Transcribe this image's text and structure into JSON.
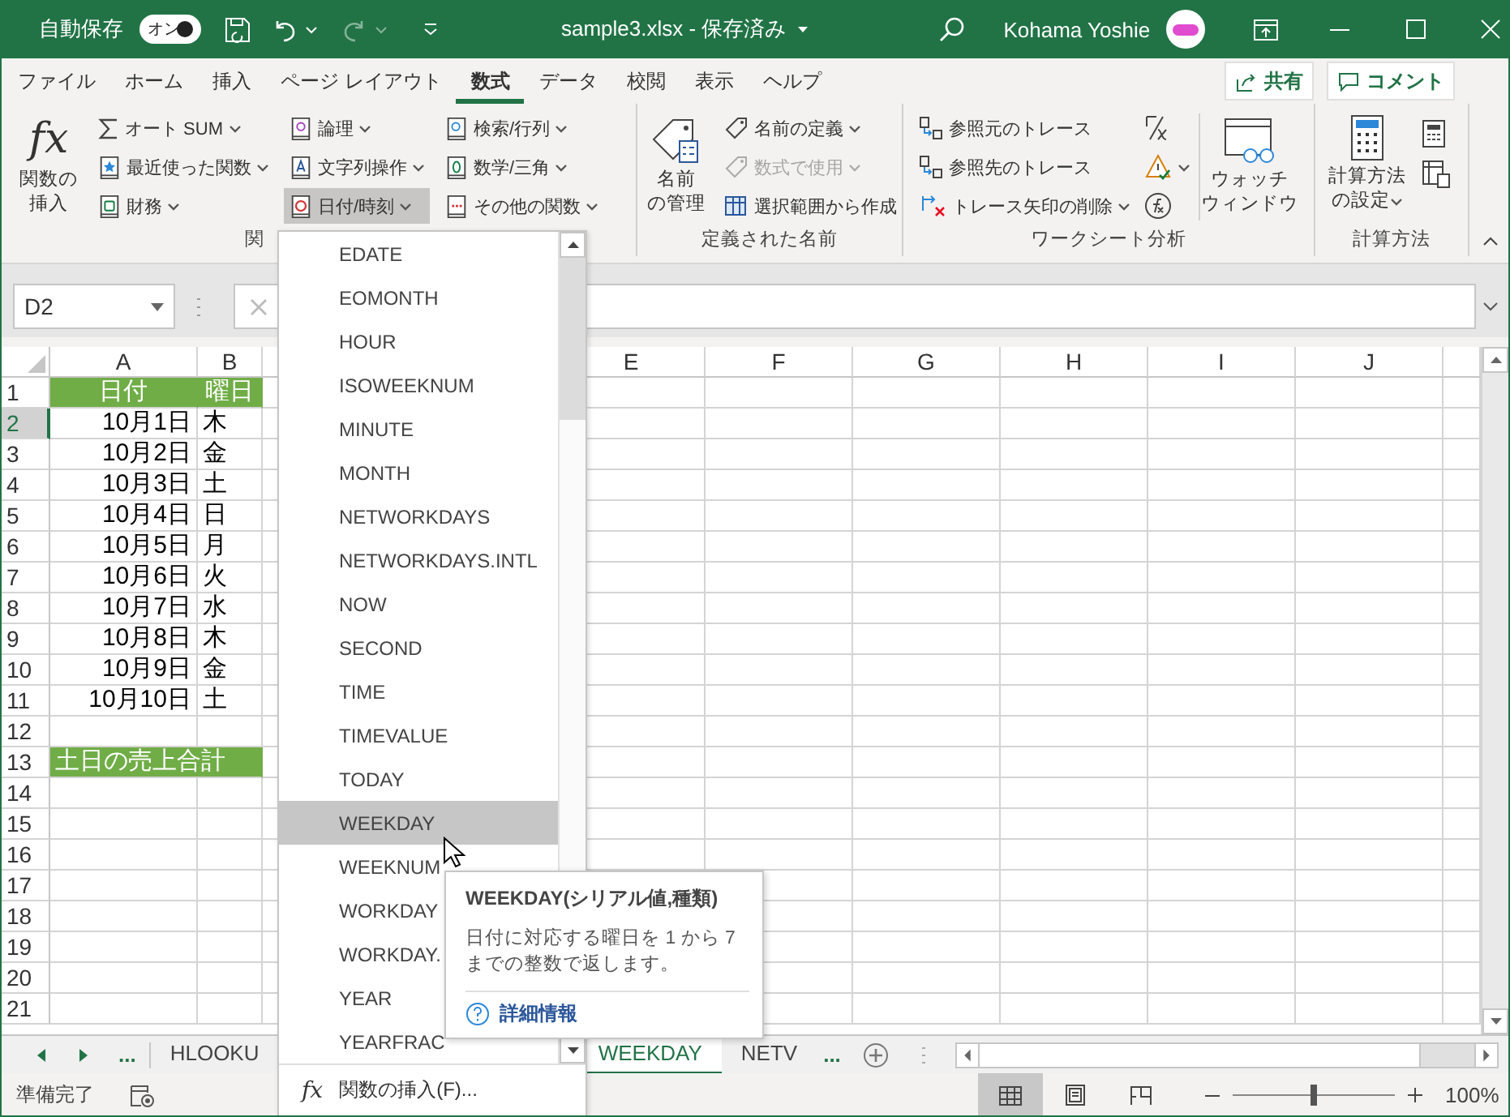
{
  "titlebar": {
    "autosave": "自動保存",
    "toggle": {
      "label": "オン",
      "on": true
    },
    "redo": {
      "disabled": true
    },
    "title": "sample3.xlsx - 保存済み",
    "user": "Kohama Yoshie"
  },
  "tabs": [
    {
      "label": "ファイル",
      "selected": false
    },
    {
      "label": "ホーム",
      "selected": false
    },
    {
      "label": "挿入",
      "selected": false
    },
    {
      "label": "ページ レイアウト",
      "selected": false
    },
    {
      "label": "数式",
      "selected": true
    },
    {
      "label": "データ",
      "selected": false
    },
    {
      "label": "校閲",
      "selected": false
    },
    {
      "label": "表示",
      "selected": false
    },
    {
      "label": "ヘルプ",
      "selected": false
    }
  ],
  "share": "共有",
  "comment": "コメント",
  "ribbon": {
    "library": {
      "icon_text": "fx",
      "insert": [
        "関数の",
        "挿入"
      ],
      "label": "関",
      "columns": [
        [
          {
            "label": "オート SUM",
            "kind": "sum",
            "pressed": false
          },
          {
            "label": "最近使った関数",
            "kind": "recent",
            "pressed": false
          },
          {
            "label": "財務",
            "kind": "finance",
            "pressed": false
          }
        ],
        [
          {
            "label": "論理",
            "kind": "logic",
            "pressed": false
          },
          {
            "label": "文字列操作",
            "kind": "text",
            "pressed": false
          },
          {
            "label": "日付/時刻",
            "kind": "datetime",
            "pressed": true
          }
        ],
        [
          {
            "label": "検索/行列",
            "kind": "lookup",
            "pressed": false
          },
          {
            "label": "数学/三角",
            "kind": "math",
            "pressed": false
          },
          {
            "label": "その他の関数",
            "kind": "more",
            "pressed": false
          }
        ]
      ]
    },
    "names": {
      "manager": [
        "名前",
        "の管理"
      ],
      "label": "定義された名前",
      "items": [
        {
          "label": "名前の定義",
          "kind": "define",
          "caret": true,
          "disabled": false
        },
        {
          "label": "数式で使用",
          "kind": "use",
          "caret": true,
          "disabled": true
        },
        {
          "label": "選択範囲から作成",
          "kind": "create",
          "caret": false,
          "disabled": false
        }
      ]
    },
    "audit": {
      "label": "ワークシート分析",
      "watch": [
        "ウォッチ",
        "ウィンドウ"
      ],
      "items": [
        {
          "label": "参照元のトレース",
          "kind": "precedents",
          "caret": false
        },
        {
          "label": "参照先のトレース",
          "kind": "dependents",
          "caret": false
        },
        {
          "label": "トレース矢印の削除",
          "kind": "remove",
          "caret": true
        }
      ],
      "tools": [
        {
          "kind": "formulas",
          "caret": false
        },
        {
          "kind": "errorcheck",
          "caret": true
        },
        {
          "kind": "evaluate",
          "caret": false
        }
      ]
    },
    "calc": {
      "options": [
        "計算方法",
        "の設定"
      ],
      "label": "計算方法"
    }
  },
  "formula_bar": {
    "name_box": "D2"
  },
  "columns": [
    "A",
    "B",
    "E",
    "F",
    "G",
    "H",
    "I",
    "J"
  ],
  "rows": [
    {
      "header": "1",
      "kind": "title",
      "selected": false,
      "cells": [
        "日付",
        "曜日"
      ]
    },
    {
      "header": "2",
      "kind": "data",
      "selected": true,
      "cells": [
        "10月1日",
        "木"
      ]
    },
    {
      "header": "3",
      "kind": "data",
      "selected": false,
      "cells": [
        "10月2日",
        "金"
      ]
    },
    {
      "header": "4",
      "kind": "data",
      "selected": false,
      "cells": [
        "10月3日",
        "土"
      ]
    },
    {
      "header": "5",
      "kind": "data",
      "selected": false,
      "cells": [
        "10月4日",
        "日"
      ]
    },
    {
      "header": "6",
      "kind": "data",
      "selected": false,
      "cells": [
        "10月5日",
        "月"
      ]
    },
    {
      "header": "7",
      "kind": "data",
      "selected": false,
      "cells": [
        "10月6日",
        "火"
      ]
    },
    {
      "header": "8",
      "kind": "data",
      "selected": false,
      "cells": [
        "10月7日",
        "水"
      ]
    },
    {
      "header": "9",
      "kind": "data",
      "selected": false,
      "cells": [
        "10月8日",
        "木"
      ]
    },
    {
      "header": "10",
      "kind": "data",
      "selected": false,
      "cells": [
        "10月9日",
        "金"
      ]
    },
    {
      "header": "11",
      "kind": "data",
      "selected": false,
      "cells": [
        "10月10日",
        "土"
      ]
    },
    {
      "header": "12",
      "kind": "empty",
      "selected": false
    },
    {
      "header": "13",
      "kind": "total",
      "selected": false,
      "cells": [
        "土日の売上合計"
      ]
    },
    {
      "header": "14",
      "kind": "empty",
      "selected": false
    },
    {
      "header": "15",
      "kind": "empty",
      "selected": false
    },
    {
      "header": "16",
      "kind": "empty",
      "selected": false
    },
    {
      "header": "17",
      "kind": "empty",
      "selected": false
    },
    {
      "header": "18",
      "kind": "empty",
      "selected": false
    },
    {
      "header": "19",
      "kind": "empty",
      "selected": false
    },
    {
      "header": "20",
      "kind": "empty",
      "selected": false
    },
    {
      "header": "21",
      "kind": "empty",
      "selected": false
    }
  ],
  "function_menu": {
    "footer_icon": "fx",
    "footer": "関数の挿入(F)...",
    "items": [
      {
        "label": "EDATE",
        "selected": false
      },
      {
        "label": "EOMONTH",
        "selected": false
      },
      {
        "label": "HOUR",
        "selected": false
      },
      {
        "label": "ISOWEEKNUM",
        "selected": false
      },
      {
        "label": "MINUTE",
        "selected": false
      },
      {
        "label": "MONTH",
        "selected": false
      },
      {
        "label": "NETWORKDAYS",
        "selected": false
      },
      {
        "label": "NETWORKDAYS.INTL",
        "selected": false
      },
      {
        "label": "NOW",
        "selected": false
      },
      {
        "label": "SECOND",
        "selected": false
      },
      {
        "label": "TIME",
        "selected": false
      },
      {
        "label": "TIMEVALUE",
        "selected": false
      },
      {
        "label": "TODAY",
        "selected": false
      },
      {
        "label": "WEEKDAY",
        "selected": true
      },
      {
        "label": "WEEKNUM",
        "selected": false
      },
      {
        "label": "WORKDAY",
        "selected": false
      },
      {
        "label": "WORKDAY.",
        "selected": false
      },
      {
        "label": "YEAR",
        "selected": false
      },
      {
        "label": "YEARFRAC",
        "selected": false
      }
    ]
  },
  "tooltip": {
    "title": "WEEKDAY(シリアル値,種類)",
    "description": "日付に対応する曜日を 1 から 7 までの整数で返します。",
    "link": "詳細情報"
  },
  "sheet_tabs": {
    "more_left": "...",
    "more_right": "...",
    "tabs": [
      {
        "label": "HLOOKU",
        "selected": false
      },
      {
        "label": "WEEKDAY",
        "selected": true
      },
      {
        "label": "NETV",
        "selected": false
      }
    ]
  },
  "status_bar": {
    "text": "準備完了",
    "views": [
      {
        "kind": "normal",
        "selected": true
      },
      {
        "kind": "layout",
        "selected": false
      },
      {
        "kind": "pagebreak",
        "selected": false
      }
    ],
    "zoom": {
      "level": 0.5,
      "reading": "100%"
    }
  }
}
